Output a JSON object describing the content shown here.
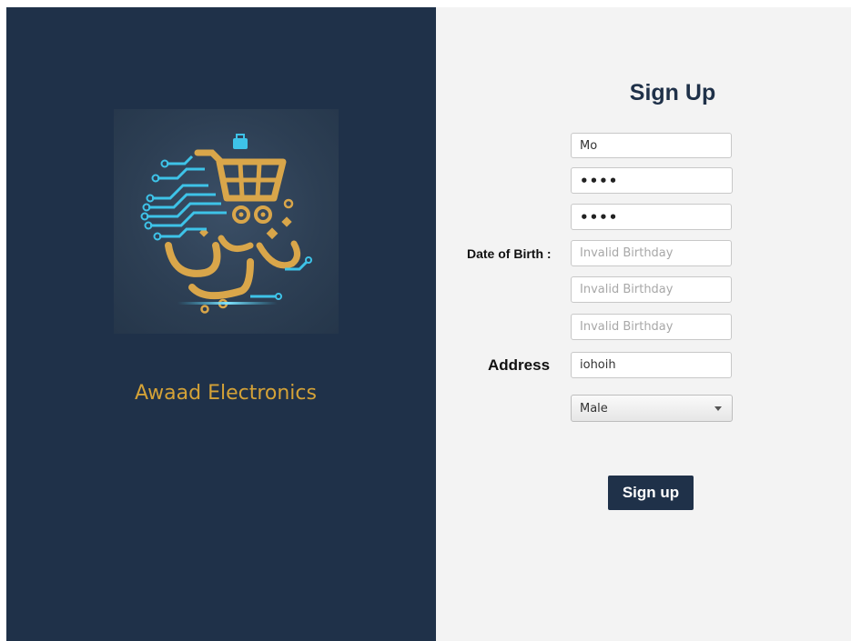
{
  "brand": {
    "name": "Awaad Electronics",
    "logo_icon": "shopping-cart-circuit-logo"
  },
  "form": {
    "title": "Sign Up",
    "username_value": "Mo",
    "password_value": "••••",
    "confirm_password_value": "••••",
    "dob_label": "Date of Birth :",
    "dob_day_placeholder": "Invalid Birthday",
    "dob_month_placeholder": "Invalid Birthday",
    "dob_year_placeholder": "Invalid Birthday",
    "address_label": "Address",
    "address_value": "iohoih",
    "gender_selected": "Male",
    "submit_label": "Sign up"
  },
  "colors": {
    "panel_dark": "#1f3149",
    "panel_light": "#f3f3f3",
    "brand_gold": "#d4a237",
    "circuit_cyan": "#3ec3e8"
  }
}
